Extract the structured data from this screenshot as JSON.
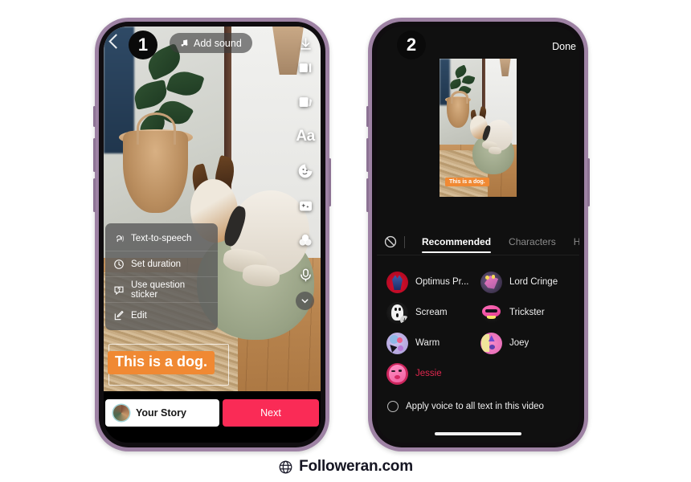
{
  "footer": {
    "brand": "Followeran.com",
    "globe_icon": "globe-icon"
  },
  "phone1": {
    "badge": "1",
    "top": {
      "back_icon": "back-arrow-icon",
      "add_sound_label": "Add sound",
      "music_icon": "music-note-icon"
    },
    "rail": [
      {
        "icon": "download-icon",
        "label": ""
      },
      {
        "icon": "split-clip-icon",
        "label": ""
      },
      {
        "icon": "templates-icon",
        "label": ""
      },
      {
        "icon": "text-icon",
        "label": "Aa"
      },
      {
        "icon": "sticker-icon",
        "label": ""
      },
      {
        "icon": "effects-sparkle-icon",
        "label": ""
      },
      {
        "icon": "filters-icon",
        "label": ""
      },
      {
        "icon": "voice-effects-icon",
        "label": ""
      },
      {
        "icon": "chevron-down-icon",
        "label": ""
      }
    ],
    "context_menu": [
      {
        "icon": "text-to-speech-icon",
        "label": "Text-to-speech"
      },
      {
        "icon": "clock-icon",
        "label": "Set duration"
      },
      {
        "icon": "question-sticker-icon",
        "label": "Use question sticker"
      },
      {
        "icon": "edit-pencil-icon",
        "label": "Edit"
      }
    ],
    "caption_text": "This is a dog.",
    "caption_color": "#f08933",
    "bottom": {
      "your_story_label": "Your Story",
      "next_label": "Next",
      "next_color": "#fa2b56",
      "avatar_icon": "story-avatar"
    }
  },
  "phone2": {
    "badge": "2",
    "done_label": "Done",
    "preview_caption": "This is a dog.",
    "no_voice_icon": "no-voice-icon",
    "tabs": [
      {
        "label": "Recommended",
        "active": true
      },
      {
        "label": "Characters",
        "active": false
      },
      {
        "label": "Humor",
        "active": false
      }
    ],
    "voices": [
      {
        "name": "Optimus Pr...",
        "selected": false,
        "has_download": false,
        "avatar": "optimus-prime-avatar"
      },
      {
        "name": "Lord Cringe",
        "selected": false,
        "has_download": false,
        "avatar": "lord-cringe-avatar"
      },
      {
        "name": "Scream",
        "selected": false,
        "has_download": true,
        "avatar": "scream-avatar"
      },
      {
        "name": "Trickster",
        "selected": false,
        "has_download": false,
        "avatar": "trickster-avatar"
      },
      {
        "name": "Warm",
        "selected": false,
        "has_download": false,
        "avatar": "warm-avatar"
      },
      {
        "name": "Joey",
        "selected": false,
        "has_download": false,
        "avatar": "joey-avatar"
      },
      {
        "name": "Jessie",
        "selected": true,
        "has_download": false,
        "avatar": "jessie-avatar"
      }
    ],
    "selected_color": "#e0274f",
    "apply_all_label": "Apply voice to all text in this video",
    "apply_all_checked": false
  }
}
